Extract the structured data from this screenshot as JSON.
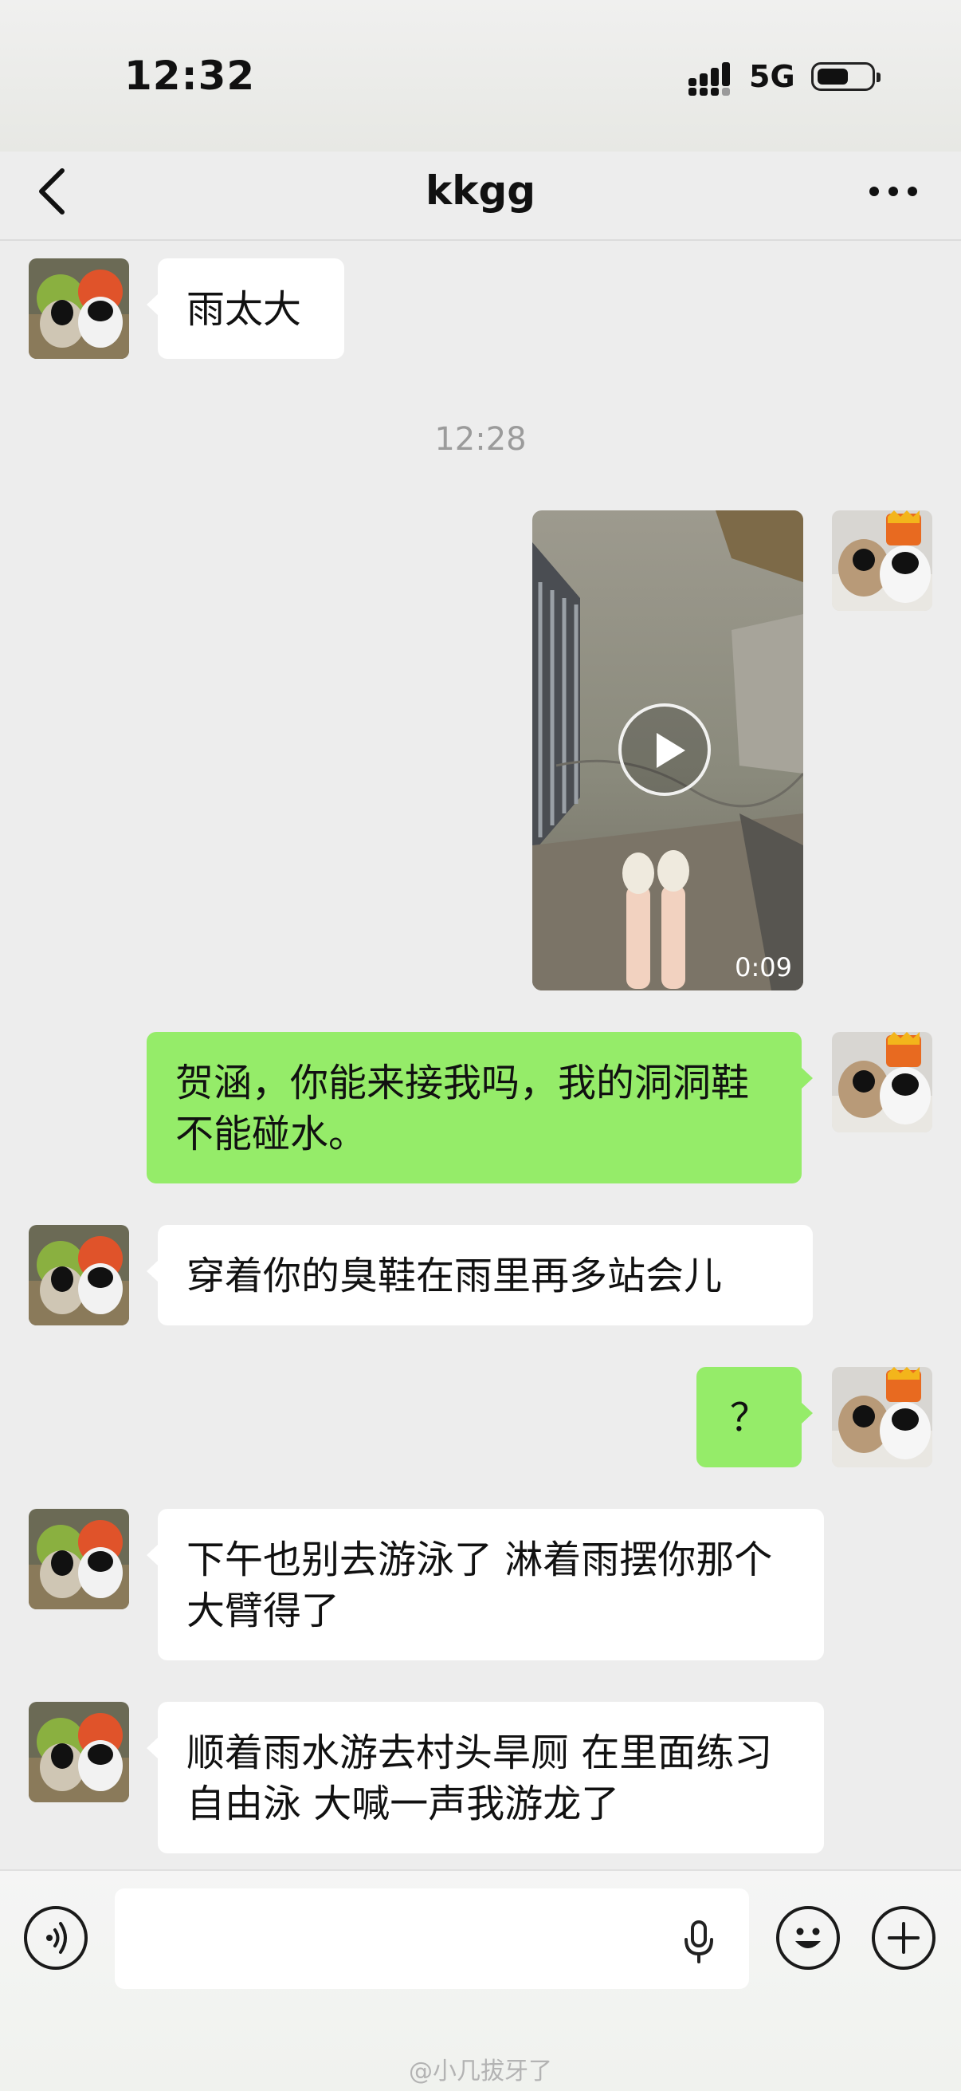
{
  "status_bar": {
    "time": "12:32",
    "network": "5G"
  },
  "header": {
    "title": "kkgg"
  },
  "messages": [
    {
      "type": "text",
      "direction": "incoming",
      "text": "雨太大"
    },
    {
      "type": "timestamp",
      "text": "12:28"
    },
    {
      "type": "video",
      "direction": "outgoing",
      "duration": "0:09"
    },
    {
      "type": "text",
      "direction": "outgoing",
      "text": "贺涵，你能来接我吗，我的洞洞鞋不能碰水。"
    },
    {
      "type": "text",
      "direction": "incoming",
      "text": "穿着你的臭鞋在雨里再多站会儿"
    },
    {
      "type": "text",
      "direction": "outgoing",
      "text": "？"
    },
    {
      "type": "text",
      "direction": "incoming",
      "text": "下午也别去游泳了 淋着雨摆你那个大臂得了"
    },
    {
      "type": "text",
      "direction": "incoming",
      "text": "顺着雨水游去村头旱厕 在里面练习自由泳 大喊一声我游龙了"
    }
  ],
  "input_bar": {
    "text_value": ""
  },
  "watermark": "@小几拔牙了",
  "colors": {
    "background": "#ededed",
    "outgoing_bubble": "#95ec69",
    "incoming_bubble": "#ffffff"
  },
  "icons": [
    "back-arrow-icon",
    "more-icon",
    "voice-icon",
    "microphone-icon",
    "emoji-icon",
    "plus-icon",
    "play-icon",
    "signal-icon",
    "battery-icon"
  ]
}
